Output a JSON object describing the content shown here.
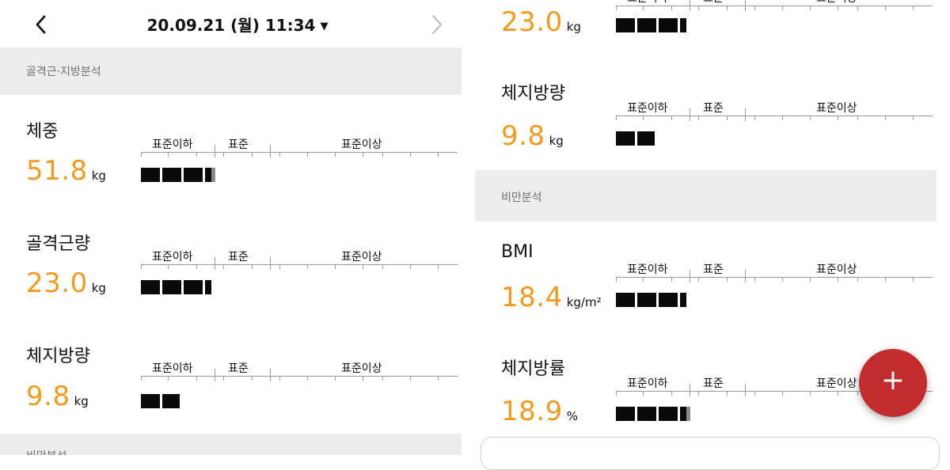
{
  "header": {
    "date": "20.09.21 (월) 11:34",
    "caret": "▼",
    "back_icon": "chevron-left-icon",
    "forward_icon": "chevron-right-icon"
  },
  "scale_labels": {
    "below": "표준이하",
    "standard": "표준",
    "above": "표준이상"
  },
  "left": {
    "section_top": "골격근·지방분석",
    "section_bottom": "비만분석",
    "metrics": [
      {
        "label": "체중",
        "value": "51.8",
        "unit": "kg",
        "level": 1.02
      },
      {
        "label": "골격근량",
        "value": "23.0",
        "unit": "kg",
        "level": 1.0
      },
      {
        "label": "체지방량",
        "value": "9.8",
        "unit": "kg",
        "level": 0.55
      }
    ]
  },
  "right": {
    "top_value": "23.0",
    "top_unit": "kg",
    "section": "비만분석",
    "metrics": [
      {
        "label": "체지방량",
        "value": "9.8",
        "unit": "kg",
        "level": 0.55
      },
      {
        "label": "BMI",
        "value": "18.4",
        "unit": "kg/m²",
        "level": 1.0
      },
      {
        "label": "체지방률",
        "value": "18.9",
        "unit": "%",
        "level": 1.03
      }
    ]
  },
  "fab": {
    "label": "+",
    "icon": "plus-icon",
    "color": "#c32c2c"
  },
  "colors": {
    "accent": "#f39a1d",
    "section_bg": "#ececec",
    "bar": "#0a0a0a"
  }
}
